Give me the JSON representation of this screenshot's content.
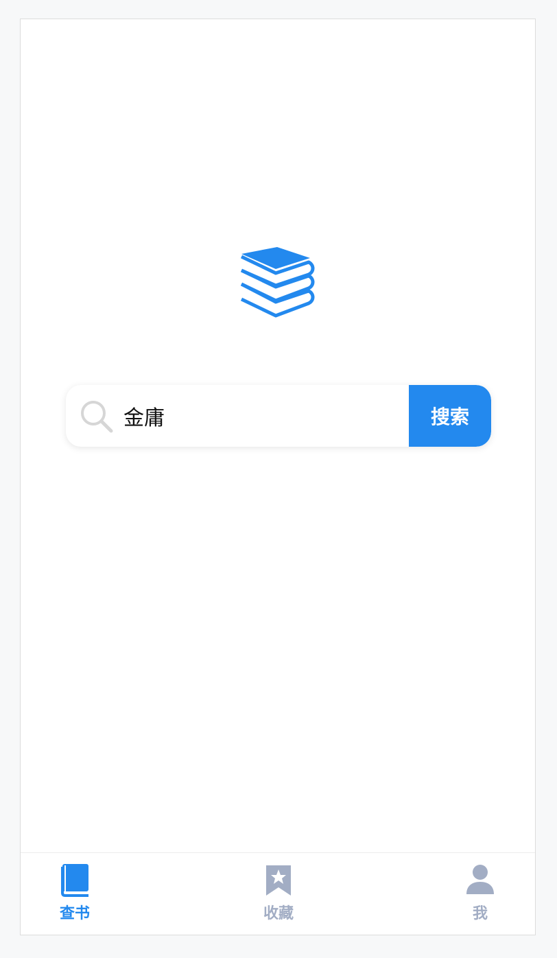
{
  "search": {
    "value": "金庸",
    "button_label": "搜索"
  },
  "tabbar": {
    "items": [
      {
        "label": "查书",
        "icon": "book-icon",
        "active": true
      },
      {
        "label": "收藏",
        "icon": "bookmark-star-icon",
        "active": false
      },
      {
        "label": "我",
        "icon": "user-icon",
        "active": false
      }
    ]
  },
  "colors": {
    "accent": "#2389ee",
    "inactive": "#a2adc4",
    "search_icon": "#d6d6d6"
  }
}
